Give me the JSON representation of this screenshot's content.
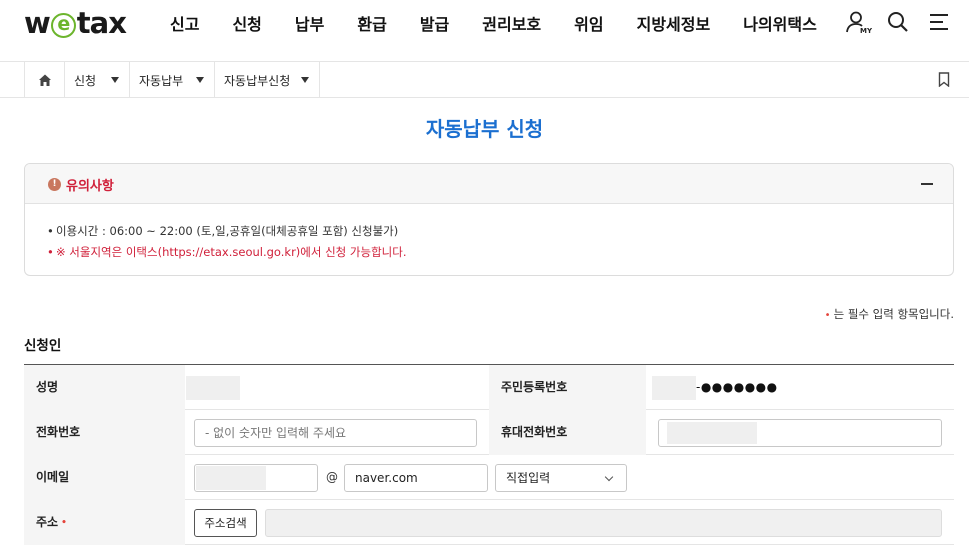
{
  "header": {
    "logo_pre": "w",
    "logo_e": "e",
    "logo_post": "tax",
    "nav": [
      "신고",
      "신청",
      "납부",
      "환급",
      "발급",
      "권리보호",
      "위임",
      "지방세정보",
      "나의위택스"
    ],
    "my_label": "MY",
    "icons": [
      "user-icon",
      "search-icon",
      "menu-icon"
    ]
  },
  "breadcrumb": {
    "home_icon": "home-icon",
    "items": [
      "신청",
      "자동납부",
      "자동납부신청"
    ],
    "bookmark_icon": "bookmark-icon"
  },
  "page": {
    "title": "자동납부 신청"
  },
  "notice": {
    "warn_glyph": "!",
    "title": "유의사항",
    "lines": [
      "이용시간 : 06:00 ~ 22:00 (토,일,공휴일(대체공휴일 포함) 신청불가)",
      "※ 서울지역은 이택스(https://etax.seoul.go.kr)에서 신청 가능합니다."
    ]
  },
  "required_note": {
    "dot": "•",
    "text": "는 필수 입력 항목입니다."
  },
  "section": {
    "title": "신청인"
  },
  "form": {
    "name_label": "성명",
    "rrn_label": "주민등록번호",
    "rrn_masked": "-●●●●●●●",
    "phone_label": "전화번호",
    "phone_placeholder": "- 없이 숫자만 입력해 주세요",
    "mobile_label": "휴대전화번호",
    "email_label": "이메일",
    "email_at": "@",
    "email_domain": "naver.com",
    "email_select": "직접입력",
    "address_label": "주소",
    "address_required": "•",
    "address_button": "주소검색"
  },
  "colors": {
    "accent_blue": "#1b6fd0",
    "alert_red": "#d0203a",
    "logo_green": "#6cb52d"
  }
}
